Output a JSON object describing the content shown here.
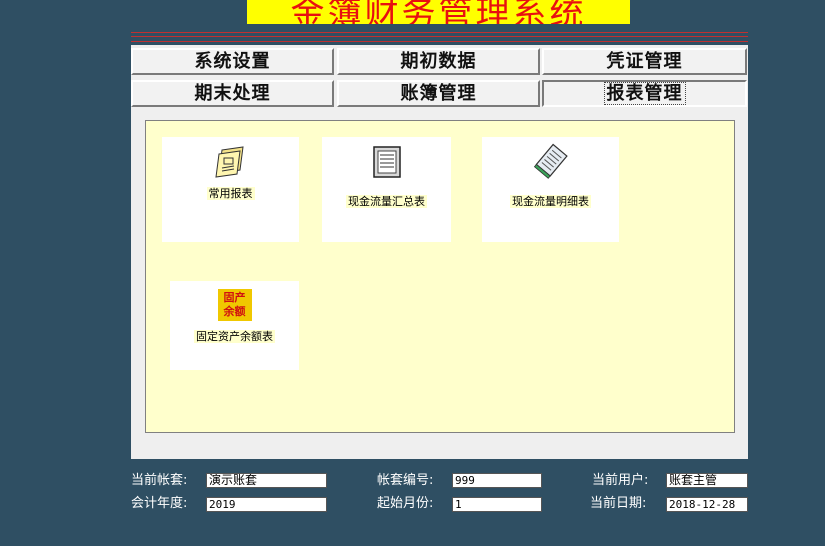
{
  "app": {
    "title": "金簿财务管理系统"
  },
  "tabs": [
    {
      "label": "系统设置",
      "active": false
    },
    {
      "label": "期初数据",
      "active": false
    },
    {
      "label": "凭证管理",
      "active": false
    },
    {
      "label": "期末处理",
      "active": false
    },
    {
      "label": "账簿管理",
      "active": false
    },
    {
      "label": "报表管理",
      "active": true
    }
  ],
  "reports": [
    {
      "label": "常用报表",
      "icon": "report-document-icon"
    },
    {
      "label": "现金流量汇总表",
      "icon": "notepad-icon"
    },
    {
      "label": "现金流量明细表",
      "icon": "notebook-icon"
    },
    {
      "label": "固定资产余额表",
      "icon": "fixed-asset-balance-icon",
      "icon_text": [
        "固产",
        "余额"
      ]
    }
  ],
  "status": {
    "account_set_label": "当前帐套:",
    "account_set_value": "演示账套",
    "account_no_label": "帐套编号:",
    "account_no_value": "999",
    "current_user_label": "当前用户:",
    "current_user_value": "账套主管",
    "fiscal_year_label": "会计年度:",
    "fiscal_year_value": "2019",
    "start_month_label": "起始月份:",
    "start_month_value": "1",
    "current_date_label": "当前日期:",
    "current_date_value": "2018-12-28"
  },
  "colors": {
    "background": "#2f4f63",
    "title_bg": "#ffff00",
    "title_text": "#e81010",
    "content_bg": "#ffffcc"
  }
}
